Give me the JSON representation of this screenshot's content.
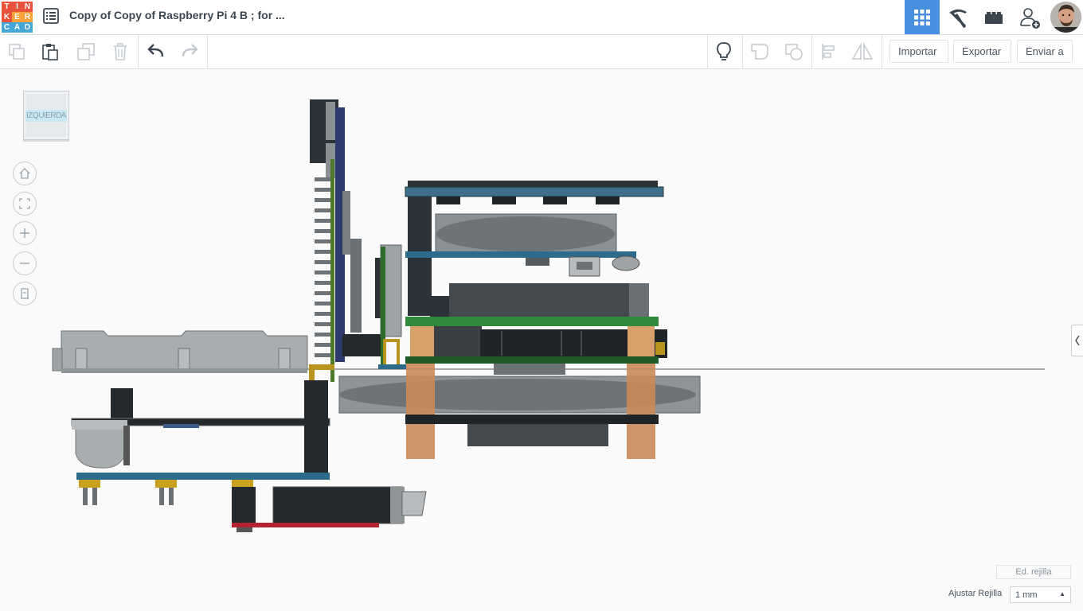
{
  "app": {
    "logo_letters": [
      "T",
      "I",
      "N",
      "K",
      "E",
      "R",
      "C",
      "A",
      "D"
    ],
    "logo_colors": [
      "#e8513c",
      "#e8513c",
      "#e8513c",
      "#f7a13b",
      "#f7a13b",
      "#f7a13b",
      "#2c9b4f",
      "#2c9b4f",
      "#2c9b4f"
    ],
    "logo_colors_alt": [
      "#e8513c",
      "#e8513c",
      "#e8513c",
      "#e8513c",
      "#f7a13b",
      "#f7a13b",
      "#45a6d8",
      "#45a6d8",
      "#45a6d8"
    ],
    "design_title": "Copy of Copy of Raspberry Pi 4 B ; for ..."
  },
  "header": {
    "view_buttons": [
      {
        "name": "3d-design",
        "icon": "grid-icon",
        "active": true
      },
      {
        "name": "blocks",
        "icon": "pickaxe-icon",
        "active": false
      },
      {
        "name": "bricks",
        "icon": "bricks-icon",
        "active": false
      },
      {
        "name": "invite",
        "icon": "add-user-icon",
        "active": false
      }
    ],
    "accent_color": "#4a90e2"
  },
  "toolbar": {
    "copy_icon": "copy-icon",
    "paste_icon": "paste-icon",
    "duplicate_icon": "duplicate-icon",
    "delete_icon": "trash-icon",
    "undo_icon": "undo-icon",
    "redo_icon": "redo-icon",
    "notes_icon": "lightbulb-icon",
    "group_icon": "group-icon",
    "ungroup_icon": "ungroup-icon",
    "align_icon": "align-icon",
    "mirror_icon": "mirror-icon",
    "import_label": "Importar",
    "export_label": "Exportar",
    "send_label": "Enviar a"
  },
  "viewcube": {
    "face_label": "IZQUIERDA"
  },
  "nav": {
    "home_icon": "home-icon",
    "fit_icon": "fit-all-icon",
    "zoom_in_icon": "zoom-in-icon",
    "zoom_out_icon": "zoom-out-icon",
    "ortho_icon": "perspective-icon"
  },
  "grid": {
    "edit_label": "Ed. rejilla",
    "snap_label": "Ajustar Rejilla",
    "snap_value": "1 mm"
  }
}
